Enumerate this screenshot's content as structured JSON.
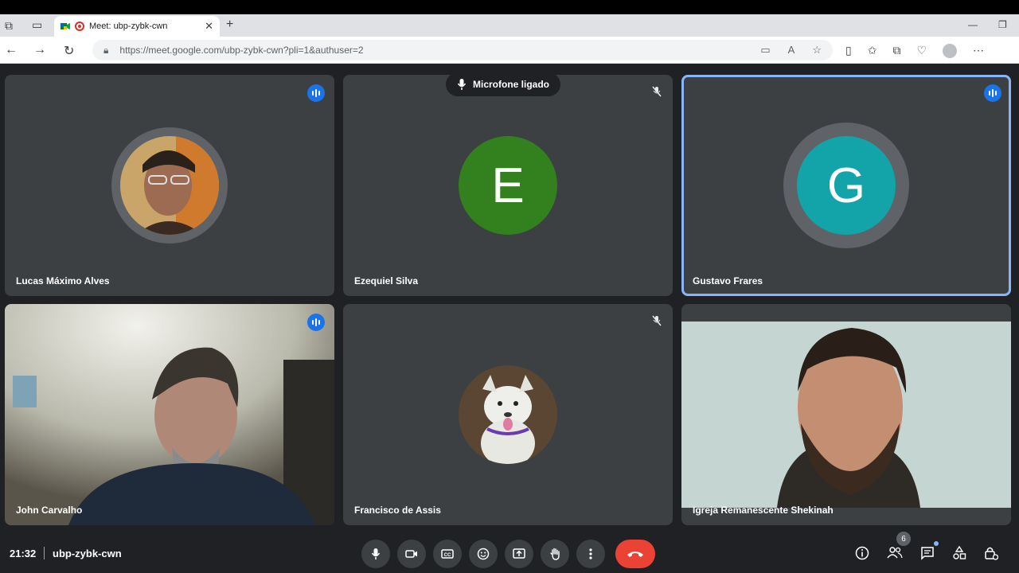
{
  "browser": {
    "tab_title": "Meet: ubp-zybk-cwn",
    "tab_close": "✕",
    "new_tab": "+",
    "url": "https://meet.google.com/ubp-zybk-cwn?pli=1&authuser=2"
  },
  "toast": {
    "label": "Microfone ligado"
  },
  "participants": [
    {
      "name": "Lucas Máximo Alves",
      "initial": "",
      "avatar_color": "#6b4a2a",
      "speaking": true
    },
    {
      "name": "Ezequiel Silva",
      "initial": "E",
      "avatar_color": "#33801e",
      "speaking": false
    },
    {
      "name": "Gustavo Frares",
      "initial": "G",
      "avatar_color": "#12a4a8",
      "speaking": true
    },
    {
      "name": "John Carvalho",
      "initial": "",
      "speaking": true
    },
    {
      "name": "Francisco de Assis",
      "initial": "",
      "speaking": false
    },
    {
      "name": "Igreja Remanescente Shekinah",
      "initial": "",
      "speaking": false
    }
  ],
  "bottom": {
    "time": "21:32",
    "meeting_code": "ubp-zybk-cwn",
    "people_count": "6"
  },
  "colors": {
    "accent": "#1a73e8",
    "end_call": "#ea4335",
    "background": "#202124",
    "tile": "#3c4043"
  }
}
